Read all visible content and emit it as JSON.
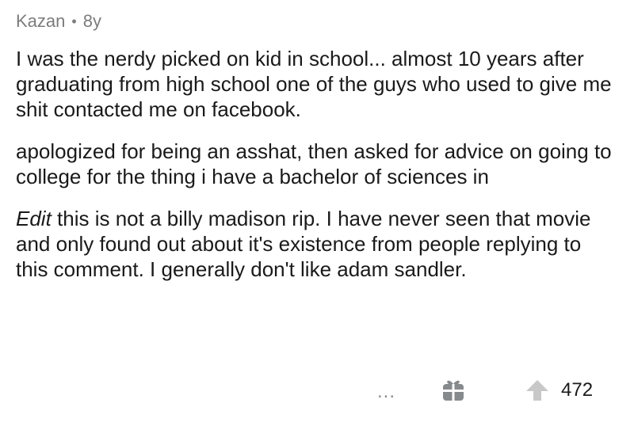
{
  "comment": {
    "author": "Kazan",
    "separator": "•",
    "age": "8y",
    "paragraphs": [
      "I was the nerdy picked on kid in school... almost 10 years after graduating from high school one of the guys who used to give me shit contacted me on facebook.",
      "apologized for being an asshat, then asked for advice on going to college for the thing i have a bachelor of sciences in"
    ],
    "edit_label": "Edit",
    "edit_text": " this is not a billy madison rip.  I have never seen that movie and only found out about it's existence from people replying to this comment.  I generally don't like adam sandler."
  },
  "actions": {
    "more_label": "...",
    "more_icon": "more-dots-icon",
    "gift_icon": "gift-icon",
    "upvote_icon": "upvote-arrow-icon",
    "score": "472"
  },
  "colors": {
    "meta": "#7c7c7c",
    "text": "#1a1a1b",
    "icon": "#878a8c",
    "upvote": "#c8c8c8"
  }
}
